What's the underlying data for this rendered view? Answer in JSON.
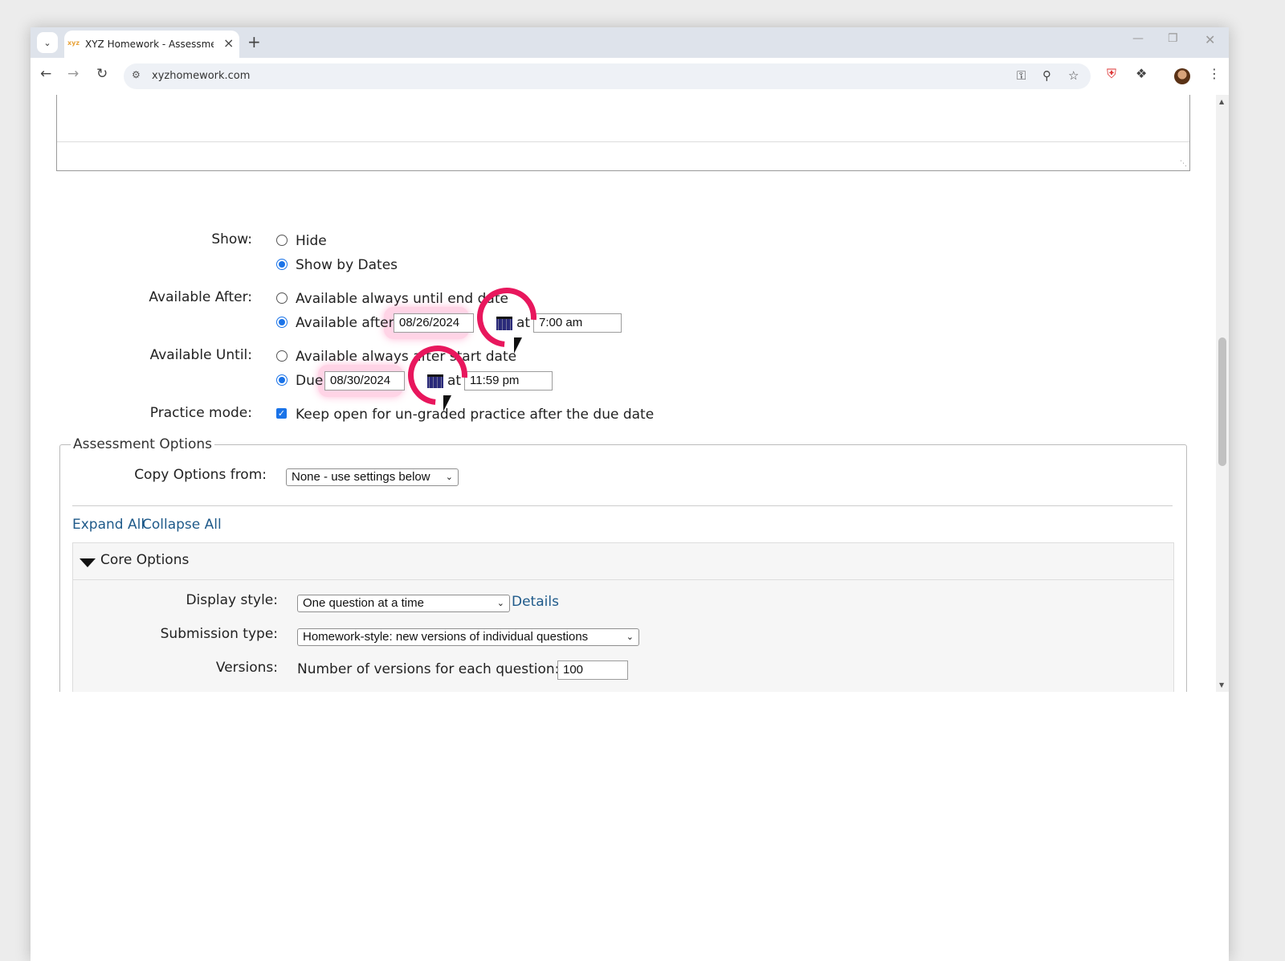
{
  "browser": {
    "tab_title": "XYZ Homework - Assessment S",
    "favicon_text": "xyz",
    "url": "xyzhomework.com",
    "icons": [
      "tab-search-icon",
      "close-icon",
      "plus-icon",
      "back-arrow-icon",
      "forward-arrow-icon",
      "reload-icon",
      "site-settings-icon",
      "password-key-icon",
      "zoom-icon",
      "star-icon",
      "extension-shield-icon",
      "puzzle-icon",
      "avatar",
      "kebab-menu-icon"
    ]
  },
  "form": {
    "show": {
      "label": "Show:",
      "options": [
        {
          "label": "Hide",
          "selected": false
        },
        {
          "label": "Show by Dates",
          "selected": true
        }
      ]
    },
    "available_after": {
      "label": "Available After:",
      "always_label": "Available always until end date",
      "after_label": "Available after",
      "date": "08/26/2024",
      "at": "at",
      "time": "7:00 am"
    },
    "available_until": {
      "label": "Available Until:",
      "always_label": "Available always after start date",
      "due_label": "Due",
      "date": "08/30/2024",
      "at": "at",
      "time": "11:59 pm"
    },
    "practice_mode": {
      "label": "Practice mode:",
      "checkbox_label": "Keep open for un-graded practice after the due date",
      "checked": true
    }
  },
  "assessment_options": {
    "legend": "Assessment Options",
    "copy_label": "Copy Options from:",
    "copy_value": "None - use settings below",
    "expand_all": "Expand All",
    "collapse_all": "Collapse All",
    "core": {
      "title": "Core Options",
      "display_label": "Display style:",
      "display_value": "One question at a time",
      "details_link": "Details",
      "submission_label": "Submission type:",
      "submission_value": "Homework-style: new versions of individual questions",
      "versions_label": "Versions:",
      "versions_text": "Number of versions for each question:",
      "versions_value": "100"
    }
  },
  "colors": {
    "accent": "#1a73e8",
    "highlight": "#e8175d",
    "link": "#1f5a8a"
  }
}
